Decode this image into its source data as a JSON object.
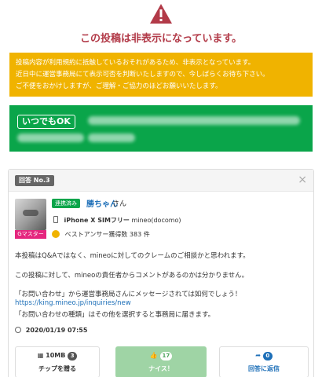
{
  "warning": {
    "icon": "warning-triangle-icon",
    "title": "この投稿は非表示になっています。",
    "color": "#b23a48"
  },
  "notice": {
    "lines": [
      "投稿内容が利用規約に抵触しているおそれがあるため、非表示となっています。",
      "近日中に運営事務局にて表示可否を判断いたしますので、今しばらくお待ち下さい。",
      "ご不便をおかけしますが、ご理解・ご協力のほどお願いいたします。"
    ],
    "color": "#f0b300"
  },
  "promo": {
    "badge": "いつでもOK",
    "color": "#0aa54a"
  },
  "card": {
    "answer_no": "回答 No.3",
    "close": "×",
    "user": {
      "avatar": "cat-photo",
      "rank": "Gマスター",
      "verified": "連携済み",
      "name": "勝ちゃん",
      "suffix": "さん",
      "device_model": "iPhone X SIMフリー",
      "device_plan": "mineo(docomo)",
      "best_answers": "ベストアンサー獲得数 383 件"
    },
    "body": {
      "p1": "本投稿はQ&Aではなく、mineoに対してのクレームのご相談かと思われます。",
      "p2": "この投稿に対して、mineoの責任者からコメントがあるのかは分かりません。",
      "p3": "「お問い合わせ」から運営事務局さんにメッセージされては如何でしょう！",
      "link": "https://king.mineo.jp/inquiries/new",
      "p4": "「お問い合わせの種類」はその他を選択すると事務局に届きます。"
    },
    "date": "2020/01/19 07:55",
    "buttons": {
      "chip": {
        "top": "10MB",
        "count": "3",
        "label": "チップを贈る"
      },
      "nice": {
        "count": "17",
        "label": "ナイス！"
      },
      "reply": {
        "count": "0",
        "label": "回答に返信"
      }
    }
  }
}
